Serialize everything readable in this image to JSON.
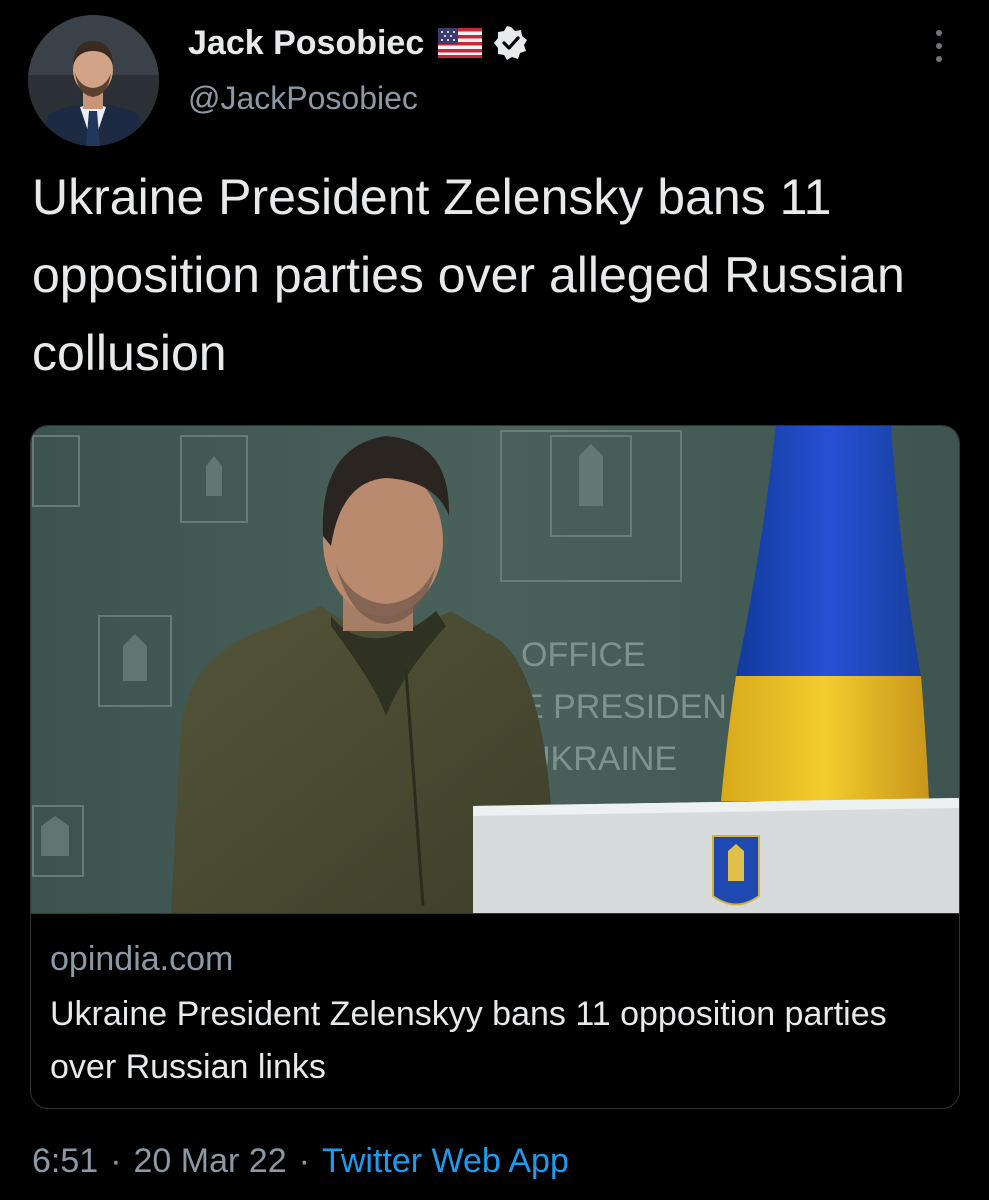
{
  "author": {
    "display_name": "Jack Posobiec",
    "handle": "@JackPosobiec",
    "flag_icon": "us-flag-icon",
    "verified_icon": "verified-badge-icon"
  },
  "tweet": {
    "text": "Ukraine President Zelensky bans 11 opposition parties over alleged Russian collusion"
  },
  "link_card": {
    "domain": "opindia.com",
    "title": "Ukraine President Zelenskyy bans 11 opposition parties over Russian links",
    "image_wall_text": [
      "OFFICE",
      "E PRESIDEN",
      "UKRAINE"
    ]
  },
  "footer": {
    "time": "6:51",
    "separator": "·",
    "date": "20 Mar 22",
    "source": "Twitter Web App"
  },
  "colors": {
    "background": "#000000",
    "text_primary": "#e7e9ea",
    "text_secondary": "#8b98a5",
    "link": "#1d9bf0",
    "border": "#2f3336",
    "flag_blue": "#0057b7",
    "flag_yellow": "#ffd700"
  }
}
